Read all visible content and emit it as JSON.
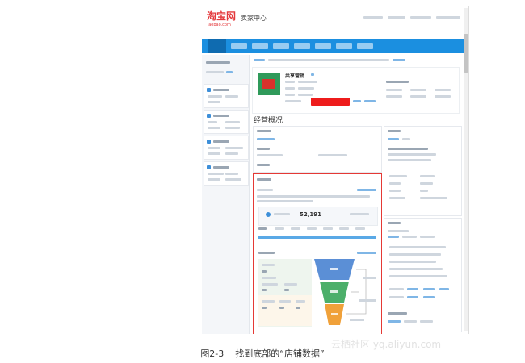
{
  "header": {
    "logo_text": "淘宝网",
    "logo_subtext": "Taobao.com",
    "seller_center": "卖家中心"
  },
  "shop": {
    "name": "共享营销"
  },
  "main": {
    "title": "经营概况"
  },
  "shop_data_panel": {
    "uv_value": "52,191"
  },
  "caption": {
    "figure": "图2-3",
    "text": "找到底部的“店铺数据”"
  },
  "watermark": "云栖社区 yq.aliyun.com",
  "colors": {
    "nav": "#1b8fe0",
    "highlight": "#e53935",
    "brand": "#e4393c"
  }
}
